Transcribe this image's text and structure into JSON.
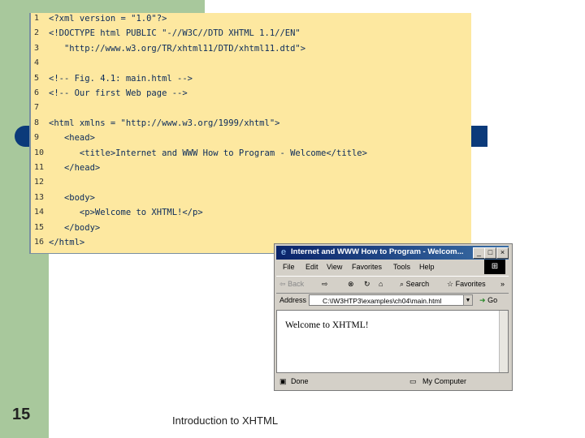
{
  "slide": {
    "number": "15",
    "footer": "Introduction to XHTML"
  },
  "code": {
    "lines": [
      {
        "n": "1",
        "text": "<?xml version = \"1.0\"?>"
      },
      {
        "n": "2",
        "text": "<!DOCTYPE html PUBLIC \"-//W3C//DTD XHTML 1.1//EN\""
      },
      {
        "n": "3",
        "text": "   \"http://www.w3.org/TR/xhtml11/DTD/xhtml11.dtd\">"
      },
      {
        "n": "4",
        "text": ""
      },
      {
        "n": "5",
        "text": "<!-- Fig. 4.1: main.html -->"
      },
      {
        "n": "6",
        "text": "<!-- Our first Web page -->"
      },
      {
        "n": "7",
        "text": ""
      },
      {
        "n": "8",
        "text": "<html xmlns = \"http://www.w3.org/1999/xhtml\">"
      },
      {
        "n": "9",
        "text": "   <head>"
      },
      {
        "n": "10",
        "text": "      <title>Internet and WWW How to Program - Welcome</title>"
      },
      {
        "n": "11",
        "text": "   </head>"
      },
      {
        "n": "12",
        "text": ""
      },
      {
        "n": "13",
        "text": "   <body>"
      },
      {
        "n": "14",
        "text": "      <p>Welcome to XHTML!</p>"
      },
      {
        "n": "15",
        "text": "   </body>"
      },
      {
        "n": "16",
        "text": "</html>"
      }
    ]
  },
  "browser": {
    "title": "Internet and WWW How to Program - Welcom...",
    "menu": [
      "File",
      "Edit",
      "View",
      "Favorites",
      "Tools",
      "Help"
    ],
    "toolbar": {
      "back": "Back",
      "search": "Search",
      "favorites": "Favorites"
    },
    "address_label": "Address",
    "address_value": "C:\\IW3HTP3\\examples\\ch04\\main.html",
    "go_label": "Go",
    "page_text": "Welcome to XHTML!",
    "status_left": "Done",
    "status_right": "My Computer"
  },
  "colors": {
    "sidebar": "#a8c89c",
    "accent_bar": "#0b3a7a",
    "code_bg": "#fde8a0"
  }
}
